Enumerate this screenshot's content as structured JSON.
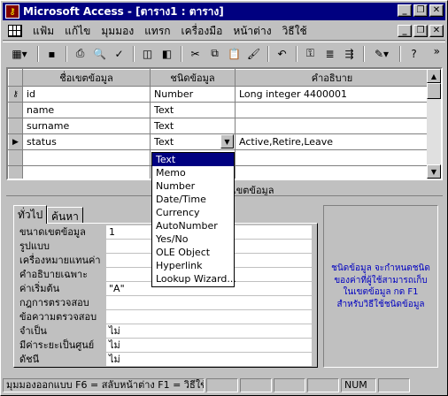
{
  "window": {
    "title": "Microsoft Access - [ตาราง1 : ตาราง]"
  },
  "menu": {
    "items": [
      "แฟ้ม",
      "แก้ไข",
      "มุมมอง",
      "แทรก",
      "เครื่องมือ",
      "หน้าต่าง",
      "วิธีใช้"
    ]
  },
  "toolbar": {
    "icons": [
      "view-design-icon",
      "save-icon",
      "print-icon",
      "print-preview-icon",
      "spelling-icon",
      "cut-icon",
      "copy-icon",
      "paste-icon",
      "format-painter-icon",
      "undo-icon",
      "primary-key-icon",
      "indexes-icon",
      "insert-rows-icon",
      "build-icon",
      "help-icon"
    ]
  },
  "design": {
    "headers": [
      "ชื่อเขตข้อมูล",
      "ชนิดข้อมูล",
      "คำอธิบาย"
    ],
    "rows": [
      {
        "marker": "key",
        "name": "id",
        "type": "Number",
        "desc": "Long integer 4400001"
      },
      {
        "marker": "",
        "name": "name",
        "type": "Text",
        "desc": ""
      },
      {
        "marker": "",
        "name": "surname",
        "type": "Text",
        "desc": ""
      },
      {
        "marker": "current",
        "name": "status",
        "type": "Text",
        "desc": "Active,Retire,Leave"
      },
      {
        "marker": "",
        "name": "",
        "type": "",
        "desc": ""
      },
      {
        "marker": "",
        "name": "",
        "type": "",
        "desc": ""
      }
    ]
  },
  "field_props_caption": "เขตข้อมูล",
  "dropdown": {
    "options": [
      "Text",
      "Memo",
      "Number",
      "Date/Time",
      "Currency",
      "AutoNumber",
      "Yes/No",
      "OLE Object",
      "Hyperlink",
      "Lookup Wizard..."
    ],
    "selected": "Text"
  },
  "tabs": [
    "ทั่วไป",
    "ค้นหา"
  ],
  "properties": [
    {
      "label": "ขนาดเขตข้อมูล",
      "value": "1"
    },
    {
      "label": "รูปแบบ",
      "value": ""
    },
    {
      "label": "เครื่องหมายแทนค่า",
      "value": ""
    },
    {
      "label": "คำอธิบายเฉพาะ",
      "value": ""
    },
    {
      "label": "ค่าเริ่มต้น",
      "value": "\"A\""
    },
    {
      "label": "กฎการตรวจสอบ",
      "value": ""
    },
    {
      "label": "ข้อความตรวจสอบ",
      "value": ""
    },
    {
      "label": "จำเป็น",
      "value": "ไม่"
    },
    {
      "label": "มีค่าระยะเป็นศูนย์",
      "value": "ไม่"
    },
    {
      "label": "ดัชนี",
      "value": "ไม่"
    }
  ],
  "help_text": "ชนิดข้อมูล จะกำหนดชนิดของค่าที่ผู้ใช้สามารถเก็บในเขตข้อมูล กด F1 สำหรับวิธีใช้ชนิดข้อมูล",
  "status": {
    "message": "มุมมองออกแบบ  F6 = สลับหน้าต่าง  F1 = วิธีใช้",
    "num": "NUM"
  }
}
